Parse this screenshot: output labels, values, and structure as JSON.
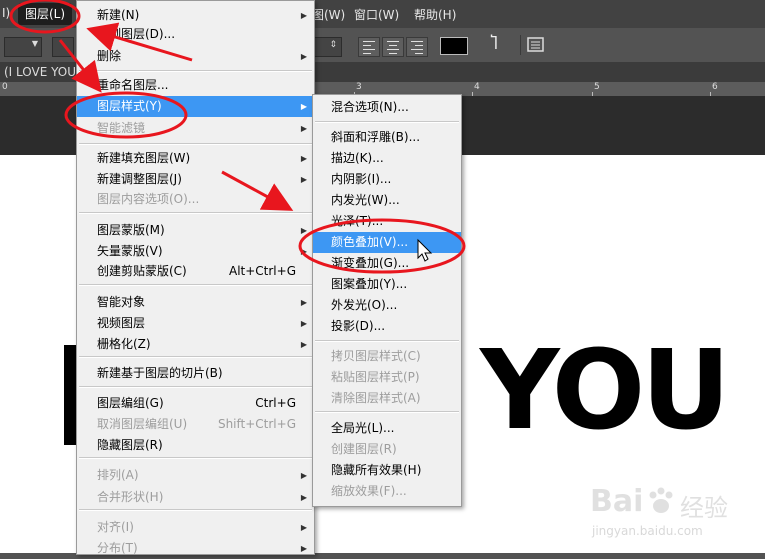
{
  "menubar": {
    "left_fragment": "I)",
    "layer_menu": "图层(L)",
    "fragment_view": "图(W)",
    "window_menu": "窗口(W)",
    "help_menu": "帮助(H)"
  },
  "document": {
    "tab_title": "(I LOVE YOU,",
    "canvas_text": "YOU",
    "ruler_labels": [
      "0",
      "3",
      "4",
      "5",
      "6"
    ]
  },
  "layer_menu": {
    "items": [
      {
        "label": "新建(N)",
        "submenu": true,
        "disabled": false
      },
      {
        "label": "复制图层(D)...",
        "disabled": false
      },
      {
        "label": "删除",
        "submenu": true,
        "disabled": false
      },
      {
        "label": "重命名图层...",
        "disabled": false
      },
      {
        "label": "图层样式(Y)",
        "submenu": true,
        "highlighted": true
      },
      {
        "label": "智能滤镜",
        "submenu": true,
        "disabled": true
      },
      {
        "label": "新建填充图层(W)",
        "submenu": true
      },
      {
        "label": "新建调整图层(J)",
        "submenu": true
      },
      {
        "label": "图层内容选项(O)...",
        "disabled": true
      },
      {
        "label": "图层蒙版(M)",
        "submenu": true
      },
      {
        "label": "矢量蒙版(V)",
        "submenu": true
      },
      {
        "label": "创建剪贴蒙版(C)",
        "shortcut": "Alt+Ctrl+G"
      },
      {
        "label": "智能对象",
        "submenu": true
      },
      {
        "label": "视频图层",
        "submenu": true
      },
      {
        "label": "栅格化(Z)",
        "submenu": true
      },
      {
        "label": "新建基于图层的切片(B)"
      },
      {
        "label": "图层编组(G)",
        "shortcut": "Ctrl+G"
      },
      {
        "label": "取消图层编组(U)",
        "shortcut": "Shift+Ctrl+G",
        "disabled": true
      },
      {
        "label": "隐藏图层(R)"
      },
      {
        "label": "排列(A)",
        "submenu": true,
        "disabled": true
      },
      {
        "label": "合并形状(H)",
        "submenu": true,
        "disabled": true
      },
      {
        "label": "对齐(I)",
        "submenu": true,
        "disabled": true
      },
      {
        "label": "分布(T)",
        "submenu": true,
        "disabled": true
      }
    ]
  },
  "layer_style_menu": {
    "items": [
      {
        "label": "混合选项(N)..."
      },
      {
        "label": "斜面和浮雕(B)..."
      },
      {
        "label": "描边(K)..."
      },
      {
        "label": "内阴影(I)..."
      },
      {
        "label": "内发光(W)..."
      },
      {
        "label": "光泽(T)..."
      },
      {
        "label": "颜色叠加(V)...",
        "highlighted": true
      },
      {
        "label": "渐变叠加(G)..."
      },
      {
        "label": "图案叠加(Y)..."
      },
      {
        "label": "外发光(O)..."
      },
      {
        "label": "投影(D)..."
      },
      {
        "label": "拷贝图层样式(C)",
        "disabled": true
      },
      {
        "label": "粘贴图层样式(P)",
        "disabled": true
      },
      {
        "label": "清除图层样式(A)",
        "disabled": true
      },
      {
        "label": "全局光(L)..."
      },
      {
        "label": "创建图层(R)",
        "disabled": true
      },
      {
        "label": "隐藏所有效果(H)"
      },
      {
        "label": "缩放效果(F)...",
        "disabled": true
      }
    ]
  },
  "watermark": {
    "brand": "Bai",
    "brand_cn": "经验",
    "url": "jingyan.baidu.com"
  },
  "colors": {
    "highlight": "#3d97f3",
    "annotation": "#e8161e",
    "menu_bg": "#f0f0f0"
  }
}
